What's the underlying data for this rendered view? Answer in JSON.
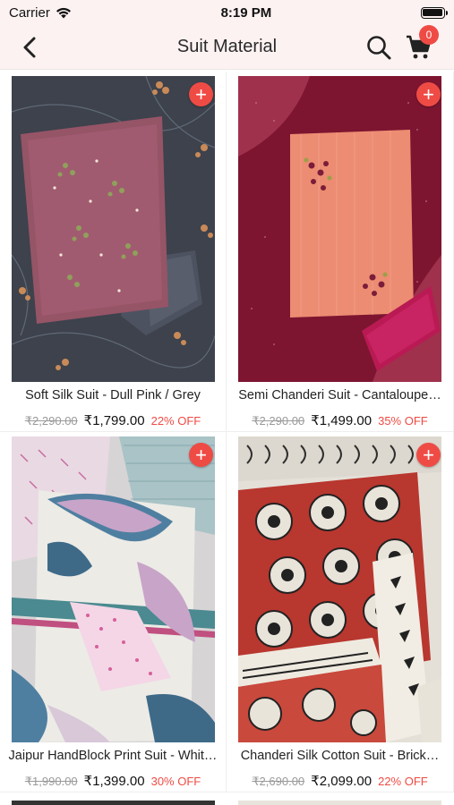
{
  "status_bar": {
    "carrier": "Carrier",
    "time": "8:19 PM"
  },
  "nav": {
    "title": "Suit Material",
    "cart_count": "0"
  },
  "colors": {
    "accent": "#ef4b45",
    "header_bg": "#fdf2f2"
  },
  "products": [
    {
      "name": "Soft Silk Suit - Dull Pink / Grey",
      "mrp": "₹2,290.00",
      "price": "₹1,799.00",
      "discount": "22% OFF",
      "image": "dull-pink-grey-suit"
    },
    {
      "name": "Semi Chanderi Suit - Cantaloupe…",
      "mrp": "₹2,290.00",
      "price": "₹1,499.00",
      "discount": "35% OFF",
      "image": "cantaloupe-maroon-suit"
    },
    {
      "name": "Jaipur HandBlock Print Suit - Whit…",
      "mrp": "₹1,990.00",
      "price": "₹1,399.00",
      "discount": "30% OFF",
      "image": "white-pink-block-print-suit"
    },
    {
      "name": "Chanderi Silk Cotton Suit - Brick…",
      "mrp": "₹2,690.00",
      "price": "₹2,099.00",
      "discount": "22% OFF",
      "image": "brick-red-block-print-suit"
    }
  ]
}
